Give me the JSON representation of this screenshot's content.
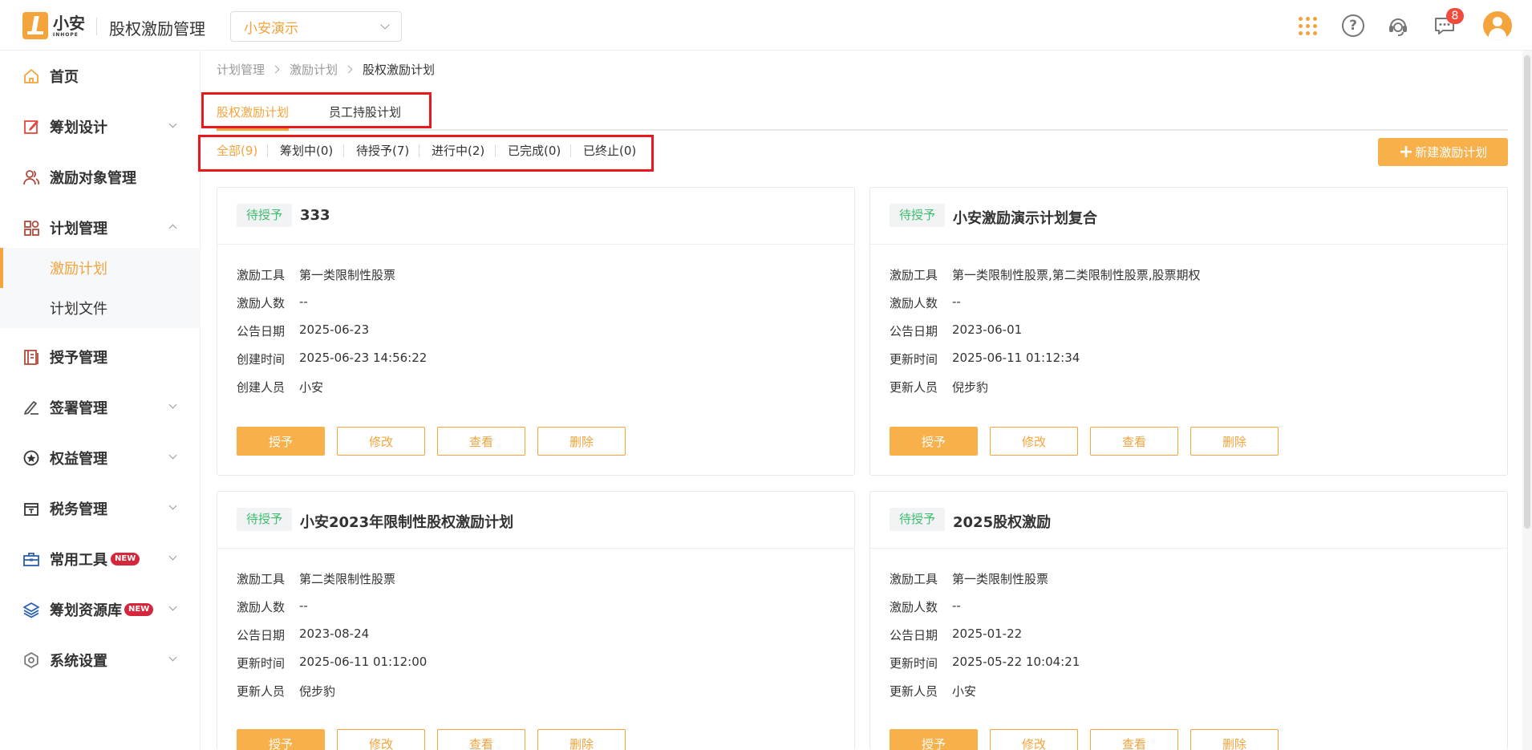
{
  "header": {
    "logo_cn": "小安",
    "logo_en": "INHOPE",
    "app_title": "股权激励管理",
    "company": "小安演示",
    "badge_count": "8",
    "accent": "#f5a33b"
  },
  "sidebar": {
    "items": [
      {
        "label": "首页",
        "icon": "home-icon"
      },
      {
        "label": "筹划设计",
        "icon": "edit-icon"
      },
      {
        "label": "激励对象管理",
        "icon": "users-icon"
      },
      {
        "label": "计划管理",
        "icon": "apps-icon"
      },
      {
        "label": "授予管理",
        "icon": "book-icon"
      },
      {
        "label": "签署管理",
        "icon": "sign-icon"
      },
      {
        "label": "权益管理",
        "icon": "star-icon"
      },
      {
        "label": "税务管理",
        "icon": "tax-icon"
      },
      {
        "label": "常用工具",
        "icon": "briefcase-icon",
        "tag": "NEW"
      },
      {
        "label": "筹划资源库",
        "icon": "layers-icon",
        "tag": "NEW"
      },
      {
        "label": "系统设置",
        "icon": "gear-icon"
      }
    ],
    "sub_items": [
      {
        "label": "激励计划"
      },
      {
        "label": "计划文件"
      }
    ]
  },
  "breadcrumb": [
    "计划管理",
    "激励计划",
    "股权激励计划"
  ],
  "tabs": [
    {
      "label": "股权激励计划"
    },
    {
      "label": "员工持股计划"
    }
  ],
  "filters": [
    {
      "label": "全部(9)"
    },
    {
      "label": "筹划中(0)"
    },
    {
      "label": "待授予(7)"
    },
    {
      "label": "进行中(2)"
    },
    {
      "label": "已完成(0)"
    },
    {
      "label": "已终止(0)"
    }
  ],
  "new_button": "新建激励计划",
  "cards": [
    {
      "status": "待授予",
      "title": "333",
      "rows": [
        {
          "k": "激励工具",
          "v": "第一类限制性股票"
        },
        {
          "k": "激励人数",
          "v": "--"
        },
        {
          "k": "公告日期",
          "v": "2025-06-23"
        },
        {
          "k": "创建时间",
          "v": "2025-06-23 14:56:22"
        },
        {
          "k": "创建人员",
          "v": "小安"
        }
      ]
    },
    {
      "status": "待授予",
      "title": "小安激励演示计划复合",
      "rows": [
        {
          "k": "激励工具",
          "v": "第一类限制性股票,第二类限制性股票,股票期权"
        },
        {
          "k": "激励人数",
          "v": "--"
        },
        {
          "k": "公告日期",
          "v": "2023-06-01"
        },
        {
          "k": "更新时间",
          "v": "2025-06-11 01:12:34"
        },
        {
          "k": "更新人员",
          "v": "倪步豹"
        }
      ]
    },
    {
      "status": "待授予",
      "title": "小安2023年限制性股权激励计划",
      "rows": [
        {
          "k": "激励工具",
          "v": "第二类限制性股票"
        },
        {
          "k": "激励人数",
          "v": "--"
        },
        {
          "k": "公告日期",
          "v": "2023-08-24"
        },
        {
          "k": "更新时间",
          "v": "2025-06-11 01:12:00"
        },
        {
          "k": "更新人员",
          "v": "倪步豹"
        }
      ]
    },
    {
      "status": "待授予",
      "title": "2025股权激励",
      "rows": [
        {
          "k": "激励工具",
          "v": "第一类限制性股票"
        },
        {
          "k": "激励人数",
          "v": "--"
        },
        {
          "k": "公告日期",
          "v": "2025-01-22"
        },
        {
          "k": "更新时间",
          "v": "2025-05-22 10:04:21"
        },
        {
          "k": "更新人员",
          "v": "小安"
        }
      ]
    }
  ],
  "card_buttons": {
    "grant": "授予",
    "edit": "修改",
    "view": "查看",
    "delete": "删除"
  }
}
